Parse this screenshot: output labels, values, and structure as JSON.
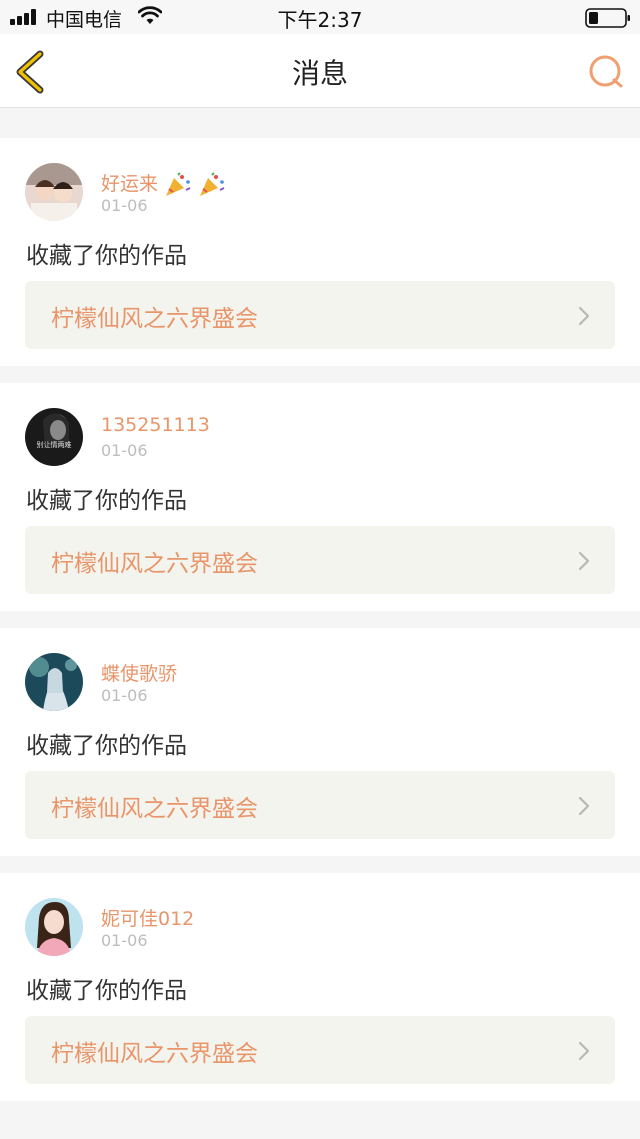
{
  "status_bar": {
    "carrier": "中国电信",
    "time": "下午2:37"
  },
  "nav": {
    "title": "消息",
    "back_icon": "chevron-left-icon",
    "search_icon": "search-icon"
  },
  "colors": {
    "accent": "#e8956a",
    "back_arrow": "#f2c200",
    "date": "#bdbdbd",
    "card_link_bg": "#f4f4ee",
    "page_bg": "#f5f5f5"
  },
  "messages": [
    {
      "username": "好运来",
      "username_icons": [
        "party-popper-icon",
        "party-popper-icon"
      ],
      "date": "01-06",
      "action": "收藏了你的作品",
      "work_title": "柠檬仙风之六界盛会"
    },
    {
      "username": "135251113",
      "date": "01-06",
      "action": "收藏了你的作品",
      "work_title": "柠檬仙风之六界盛会",
      "avatar_text": "别让情两难"
    },
    {
      "username": "蝶使歌骄",
      "date": "01-06",
      "action": "收藏了你的作品",
      "work_title": "柠檬仙风之六界盛会"
    },
    {
      "username": "妮可佳012",
      "date": "01-06",
      "action": "收藏了你的作品",
      "work_title": "柠檬仙风之六界盛会"
    }
  ]
}
